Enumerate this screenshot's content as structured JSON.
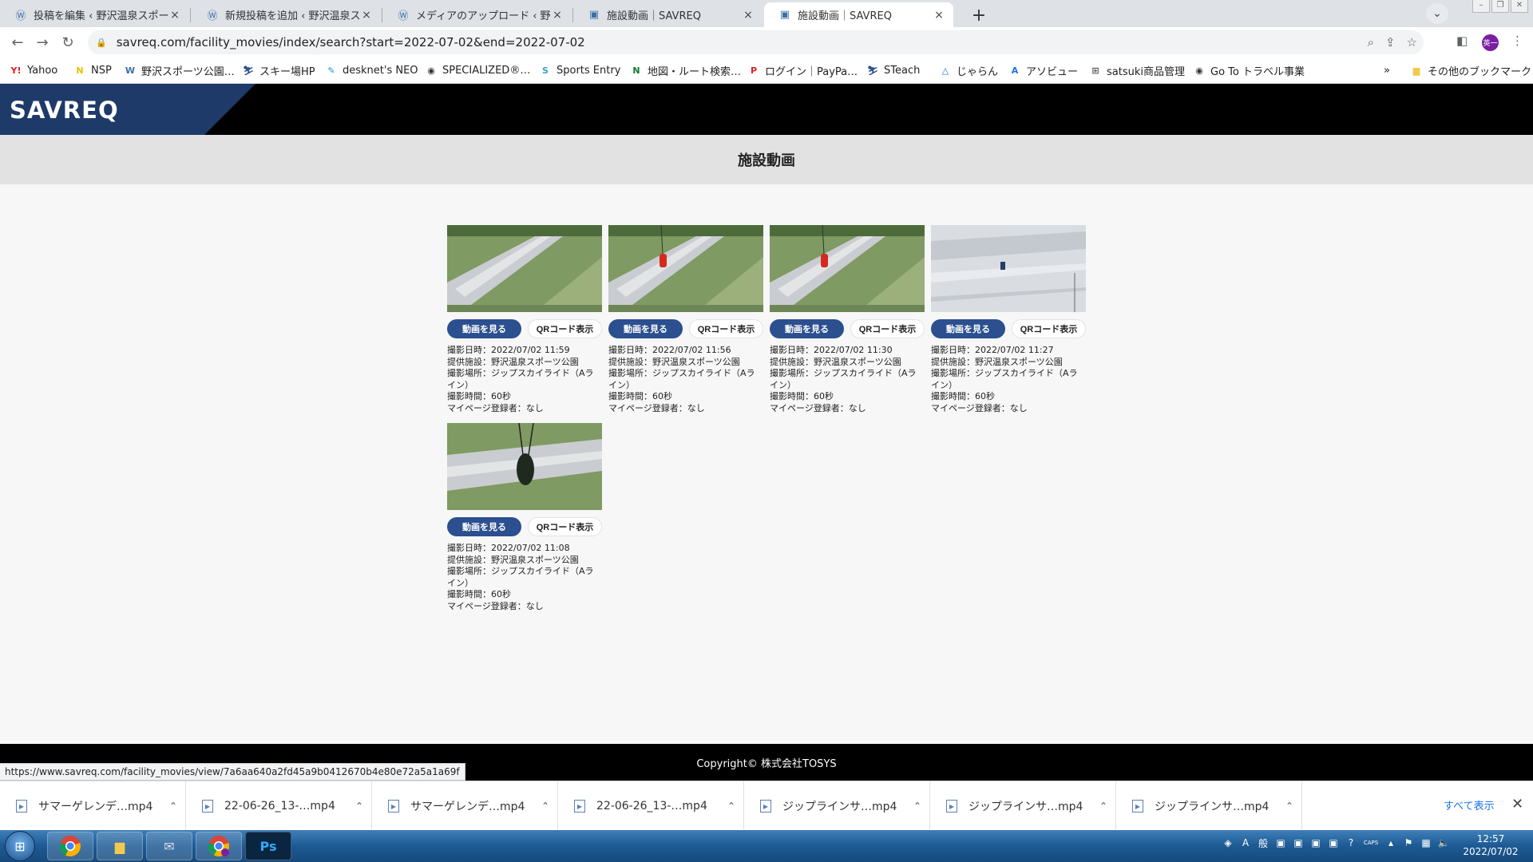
{
  "browser": {
    "tabs": [
      {
        "title": "投稿を編集 ‹ 野沢温泉スポーツ公",
        "icon": "wordpress-icon"
      },
      {
        "title": "新規投稿を追加 ‹ 野沢温泉スポー",
        "icon": "wordpress-icon"
      },
      {
        "title": "メディアのアップロード ‹ 野沢温",
        "icon": "wordpress-icon"
      },
      {
        "title": "施設動画｜SAVREQ",
        "icon": "savreq-icon"
      },
      {
        "title": "施設動画｜SAVREQ",
        "icon": "savreq-icon"
      }
    ],
    "active_tab": 4,
    "close_glyph": "×",
    "new_tab_glyph": "+",
    "url": "savreq.com/facility_movies/index/search?start=2022-07-02&end=2022-07-02",
    "avatar_label": "英一"
  },
  "bookmarks": [
    {
      "label": "Yahoo",
      "icon": "Y!",
      "color": "#e02020"
    },
    {
      "label": "NSP",
      "icon": "N",
      "color": "#e8c100"
    },
    {
      "label": "野沢スポーツ公園…",
      "icon": "W",
      "color": "#3c6ea8"
    },
    {
      "label": "スキー場HP",
      "icon": "⛷",
      "color": "#2b4f8f"
    },
    {
      "label": "desknet's NEO",
      "icon": "✎",
      "color": "#1a8fd6"
    },
    {
      "label": "SPECIALIZED®…",
      "icon": "◉",
      "color": "#333333"
    },
    {
      "label": "Sports Entry",
      "icon": "S",
      "color": "#3aa0c8"
    },
    {
      "label": "地図・ルート検索…",
      "icon": "N",
      "color": "#0a7a2a"
    },
    {
      "label": "ログイン｜PayPa…",
      "icon": "P",
      "color": "#e02020"
    },
    {
      "label": "STeach",
      "icon": "⛷",
      "color": "#2b4f8f"
    },
    {
      "label": "じゃらん",
      "icon": "△",
      "color": "#1a73e8"
    },
    {
      "label": "アソビュー",
      "icon": "A",
      "color": "#1a73e8"
    },
    {
      "label": "satsuki商品管理",
      "icon": "⊞",
      "color": "#555555"
    },
    {
      "label": "Go To トラベル事業",
      "icon": "◉",
      "color": "#333333"
    }
  ],
  "bookmarks_more": "»",
  "bookmarks_other": "その他のブックマーク",
  "site": {
    "logo": "SAVREQ",
    "page_title": "施設動画",
    "footer": "Copyright© 株式会社TOSYS"
  },
  "videos": [
    {
      "watch_label": "動画を見る",
      "qr_label": "QRコード表示",
      "datetime": "撮影日時：2022/07/02 11:59",
      "facility": "提供施設：野沢温泉スポーツ公園",
      "place": "撮影場所：ジップスカイライド（Aライン）",
      "duration": "撮影時間：60秒",
      "mypage": "マイページ登録者：なし",
      "scene": "empty-slope"
    },
    {
      "watch_label": "動画を見る",
      "qr_label": "QRコード表示",
      "datetime": "撮影日時：2022/07/02 11:56",
      "facility": "提供施設：野沢温泉スポーツ公園",
      "place": "撮影場所：ジップスカイライド（Aライン）",
      "duration": "撮影時間：60秒",
      "mypage": "マイページ登録者：なし",
      "scene": "rider-red"
    },
    {
      "watch_label": "動画を見る",
      "qr_label": "QRコード表示",
      "datetime": "撮影日時：2022/07/02 11:30",
      "facility": "提供施設：野沢温泉スポーツ公園",
      "place": "撮影場所：ジップスカイライド（Aライン）",
      "duration": "撮影時間：60秒",
      "mypage": "マイページ登録者：なし",
      "scene": "rider-red"
    },
    {
      "watch_label": "動画を見る",
      "qr_label": "QRコード表示",
      "datetime": "撮影日時：2022/07/02 11:27",
      "facility": "提供施設：野沢温泉スポーツ公園",
      "place": "撮影場所：ジップスカイライド（Aライン）",
      "duration": "撮影時間：60秒",
      "mypage": "マイページ登録者：なし",
      "scene": "snow-rider"
    },
    {
      "watch_label": "動画を見る",
      "qr_label": "QRコード表示",
      "datetime": "撮影日時：2022/07/02 11:08",
      "facility": "提供施設：野沢温泉スポーツ公園",
      "place": "撮影場所：ジップスカイライド（Aライン）",
      "duration": "撮影時間：60秒",
      "mypage": "マイページ登録者：なし",
      "scene": "rider-close"
    }
  ],
  "status_url": "https://www.savreq.com/facility_movies/view/7a6aa640a2fd45a9b0412670b4e80e72a5a1a69f",
  "downloads": {
    "items": [
      "サマーゲレンデ…mp4",
      "22-06-26_13-…mp4",
      "サマーゲレンデ…mp4",
      "22-06-26_13-…mp4",
      "ジップラインサ…mp4",
      "ジップラインサ…mp4",
      "ジップラインサ…mp4"
    ],
    "show_all": "すべて表示"
  },
  "taskbar": {
    "apps": [
      "chrome-icon",
      "explorer-icon",
      "mail-icon",
      "chrome-profile-icon",
      "photoshop-icon"
    ],
    "photoshop_label": "Ps",
    "time": "12:57",
    "date": "2022/07/02"
  }
}
